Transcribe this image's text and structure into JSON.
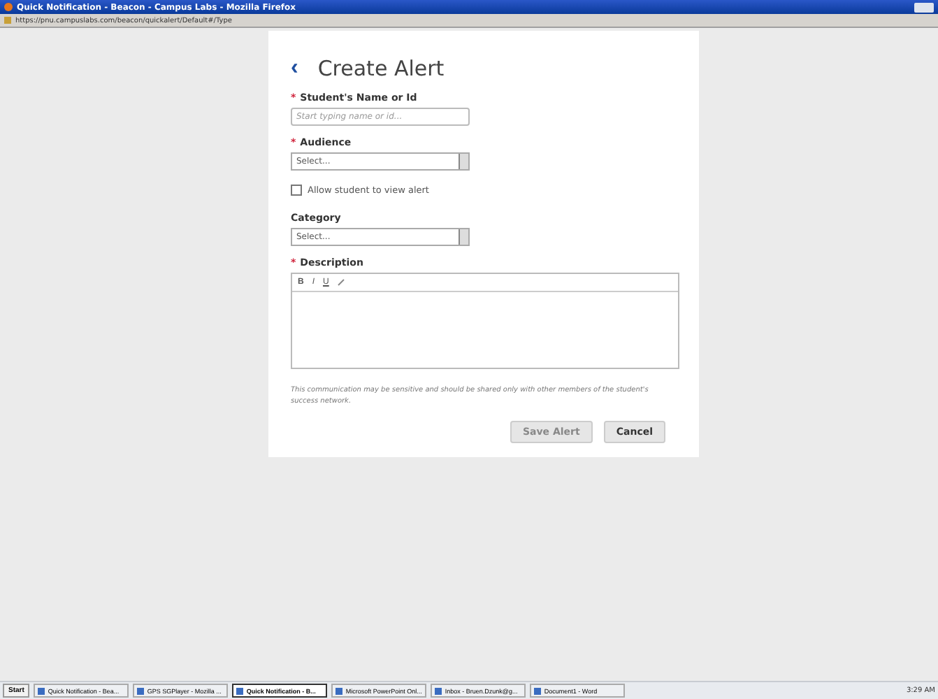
{
  "window": {
    "title": "Quick Notification - Beacon - Campus Labs - Mozilla Firefox",
    "address": "https://pnu.campuslabs.com/beacon/quickalert/Default#/Type"
  },
  "form": {
    "back": "‹",
    "title": "Create Alert",
    "required_mark": "*",
    "fields": [
      {
        "kind": "text",
        "label": "Student's Name or Id",
        "required": true,
        "placeholder": "Start typing name or id..."
      },
      {
        "kind": "select",
        "label": "Audience",
        "required": true,
        "value": "Select..."
      },
      {
        "kind": "checkbox",
        "label": "Allow student to view alert",
        "checked": false
      },
      {
        "kind": "select",
        "label": "Category",
        "required": false,
        "value": "Select..."
      },
      {
        "kind": "editor",
        "label": "Description",
        "required": true,
        "tools": [
          "B",
          "I",
          "U"
        ]
      }
    ],
    "note": "This communication may be sensitive and should be shared only with other members of the student's success network.",
    "buttons": [
      {
        "label": "Save Alert",
        "disabled": true
      },
      {
        "label": "Cancel",
        "disabled": false
      }
    ]
  },
  "taskbar": {
    "start": "Start",
    "items": [
      {
        "label": "Quick Notification - Bea...",
        "selected": false
      },
      {
        "label": "GPS SGPlayer - Mozilla ...",
        "selected": false
      },
      {
        "label": "Quick Notification - B...",
        "selected": true
      },
      {
        "label": "Microsoft PowerPoint Onl...",
        "selected": false
      },
      {
        "label": "Inbox - Bruen.Dzunk@g...",
        "selected": false
      },
      {
        "label": "Document1 - Word",
        "selected": false
      }
    ],
    "clock": "3:29 AM"
  }
}
